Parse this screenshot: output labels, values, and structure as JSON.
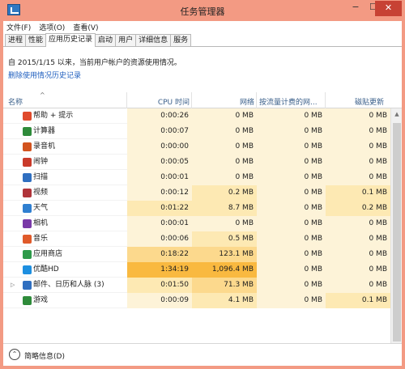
{
  "window": {
    "title": "任务管理器",
    "min_symbol": "−",
    "max_symbol": "☐",
    "close_symbol": "✕"
  },
  "menu": [
    "文件(F)",
    "选项(O)",
    "查看(V)"
  ],
  "tabs": [
    "进程",
    "性能",
    "应用历史记录",
    "启动",
    "用户",
    "详细信息",
    "服务"
  ],
  "active_tab": 2,
  "info": {
    "text": "自 2015/1/15 以来，当前用户帐户的资源使用情况。",
    "link": "删除使用情况历史记录"
  },
  "columns": {
    "name": "名称",
    "cpu": "CPU 时间",
    "network": "网络",
    "metered": "按流量计费的网...",
    "tile": "磁贴更新",
    "sort_arrow": "^"
  },
  "rows": [
    {
      "name": "帮助 + 提示",
      "icon": "help-tips-icon",
      "icon_color": "#e04a2c",
      "cpu": "0:00:26",
      "net": "0 MB",
      "metered": "0 MB",
      "tile": "0 MB"
    },
    {
      "name": "计算器",
      "icon": "calculator-icon",
      "icon_color": "#2e8b3a",
      "cpu": "0:00:07",
      "net": "0 MB",
      "metered": "0 MB",
      "tile": "0 MB"
    },
    {
      "name": "录音机",
      "icon": "recorder-icon",
      "icon_color": "#d2531e",
      "cpu": "0:00:00",
      "net": "0 MB",
      "metered": "0 MB",
      "tile": "0 MB"
    },
    {
      "name": "闹钟",
      "icon": "alarm-icon",
      "icon_color": "#c93a2a",
      "cpu": "0:00:05",
      "net": "0 MB",
      "metered": "0 MB",
      "tile": "0 MB"
    },
    {
      "name": "扫描",
      "icon": "scan-icon",
      "icon_color": "#2f6fc0",
      "cpu": "0:00:01",
      "net": "0 MB",
      "metered": "0 MB",
      "tile": "0 MB"
    },
    {
      "name": "视频",
      "icon": "video-icon",
      "icon_color": "#b0343a",
      "cpu": "0:00:12",
      "net": "0.2 MB",
      "metered": "0 MB",
      "tile": "0.1 MB"
    },
    {
      "name": "天气",
      "icon": "weather-icon",
      "icon_color": "#2f7fd0",
      "cpu": "0:01:22",
      "net": "8.7 MB",
      "metered": "0 MB",
      "tile": "0.2 MB"
    },
    {
      "name": "相机",
      "icon": "camera-icon",
      "icon_color": "#7a3aa8",
      "cpu": "0:00:01",
      "net": "0 MB",
      "metered": "0 MB",
      "tile": "0 MB"
    },
    {
      "name": "音乐",
      "icon": "music-icon",
      "icon_color": "#e05a2a",
      "cpu": "0:00:06",
      "net": "0.5 MB",
      "metered": "0 MB",
      "tile": "0 MB"
    },
    {
      "name": "应用商店",
      "icon": "store-icon",
      "icon_color": "#2e9a4a",
      "cpu": "0:18:22",
      "net": "123.1 MB",
      "metered": "0 MB",
      "tile": "0 MB"
    },
    {
      "name": "优酷HD",
      "icon": "youku-icon",
      "icon_color": "#1d8fe0",
      "cpu": "1:34:19",
      "net": "1,096.4 MB",
      "metered": "0 MB",
      "tile": "0 MB"
    },
    {
      "name": "邮件、日历和人脉 (3)",
      "icon": "mail-calendar-people-icon",
      "icon_color": "#2f6fc0",
      "cpu": "0:01:50",
      "net": "71.3 MB",
      "metered": "0 MB",
      "tile": "0 MB",
      "expandable": true,
      "expander_symbol": "▷"
    },
    {
      "name": "游戏",
      "icon": "games-icon",
      "icon_color": "#2e8b3a",
      "cpu": "0:00:09",
      "net": "4.1 MB",
      "metered": "0 MB",
      "tile": "0.1 MB"
    }
  ],
  "heat_colors": {
    "low": "#fdf3d8",
    "medium": "#fde9b3",
    "high": "#fcd98d",
    "highest": "#f9b940"
  },
  "scrollbar": {
    "up": "▲",
    "down": "▼"
  },
  "footer": {
    "label": "简略信息(D)",
    "symbol": "⌃"
  }
}
